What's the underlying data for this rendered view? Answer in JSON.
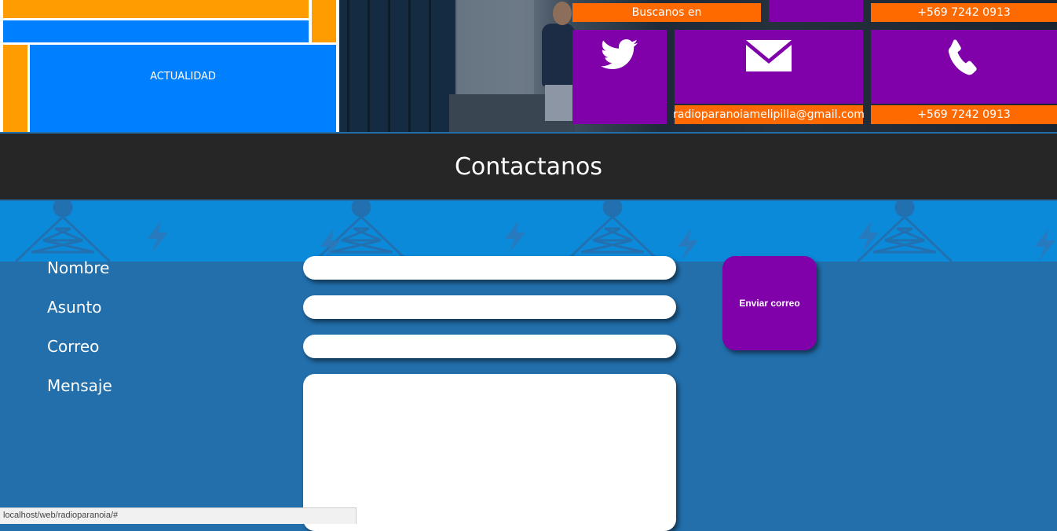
{
  "tiles": {
    "actualidad": "ACTUALIDAD"
  },
  "social": {
    "buscanos_label": "Buscanos en",
    "email": "radioparanoiamelipilla@gmail.com",
    "phone_top": "+569 7242 0913",
    "phone_bottom": "+569 7242 0913",
    "icons": [
      "twitter-icon",
      "envelope-icon",
      "phone-icon"
    ]
  },
  "contact": {
    "title": "Contactanos",
    "fields": {
      "nombre": "Nombre",
      "asunto": "Asunto",
      "correo": "Correo",
      "mensaje": "Mensaje"
    },
    "send_label": "Enviar correo"
  },
  "statusbar": {
    "url": "localhost/web/radioparanoia/#"
  },
  "colors": {
    "orange": "#ff9c00",
    "blue": "#0080ff",
    "purple": "#8000aa",
    "orange_bar": "#ff6a00",
    "header": "#262626",
    "form_bg": "#226fac"
  }
}
